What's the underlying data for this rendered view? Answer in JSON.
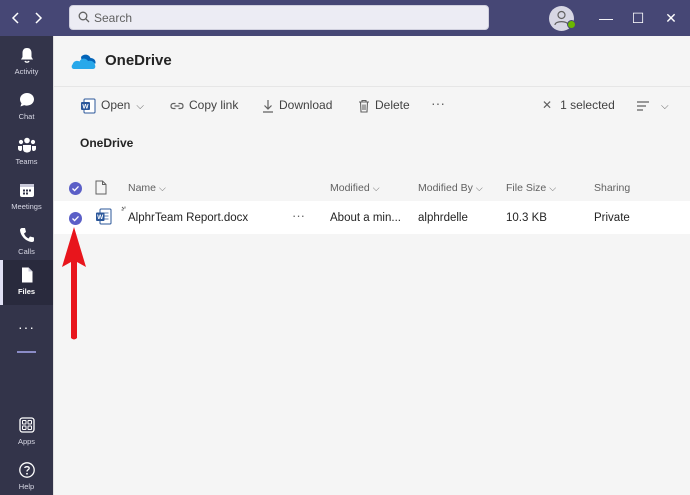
{
  "titlebar": {
    "back_icon": "chevron-left",
    "forward_icon": "chevron-right",
    "search_placeholder": "Search",
    "minimize_glyph": "—",
    "maximize_glyph": "☐",
    "close_glyph": "✕",
    "presence_color": "#6bb700"
  },
  "rail": {
    "items": [
      {
        "label": "Activity",
        "icon": "bell-icon"
      },
      {
        "label": "Chat",
        "icon": "chat-icon"
      },
      {
        "label": "Teams",
        "icon": "teams-icon"
      },
      {
        "label": "Meetings",
        "icon": "calendar-icon"
      },
      {
        "label": "Calls",
        "icon": "phone-icon"
      },
      {
        "label": "Files",
        "icon": "file-icon"
      },
      {
        "label": "Apps",
        "icon": "apps-icon"
      },
      {
        "label": "Help",
        "icon": "help-icon"
      }
    ],
    "more_glyph": "···",
    "active": "Files"
  },
  "header": {
    "title": "OneDrive",
    "logo": "onedrive-cloud-icon"
  },
  "toolbar": {
    "open_label": "Open",
    "copy_link_label": "Copy link",
    "download_label": "Download",
    "delete_label": "Delete",
    "more_glyph": "···",
    "selected_label": "1 selected",
    "close_glyph": "✕"
  },
  "breadcrumb": "OneDrive",
  "columns": {
    "name": "Name",
    "modified": "Modified",
    "modified_by": "Modified By",
    "file_size": "File Size",
    "sharing": "Sharing"
  },
  "files": [
    {
      "name": "AlphrTeam Report.docx",
      "modified": "About a min...",
      "modified_by": "alphrdelle",
      "file_size": "10.3 KB",
      "sharing": "Private",
      "more_glyph": "···",
      "selected": true
    }
  ],
  "colors": {
    "brand": "#464775",
    "rail": "#33344a",
    "accent": "#5b5fc7",
    "annotation": "#e8151c"
  }
}
